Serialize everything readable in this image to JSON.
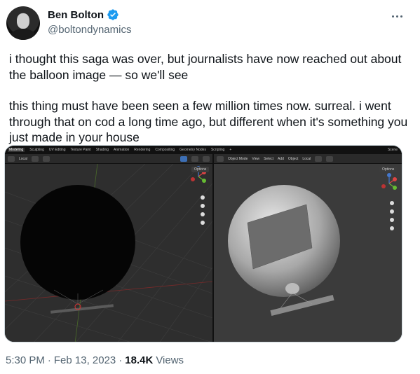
{
  "author": {
    "display_name": "Ben Bolton",
    "handle": "@boltondynamics",
    "verified_color": "#1d9bf0"
  },
  "tweet": {
    "paragraphs": [
      "i thought this saga was over, but journalists have now reached out about the balloon image — so we'll see",
      "this thing must have been seen a few million times now. surreal. i went through that on cod a long time ago, but different when it's something you just made in your house"
    ]
  },
  "media": {
    "menu_tabs": [
      "Modeling",
      "Sculpting",
      "UV Editing",
      "Texture Paint",
      "Shading",
      "Animation",
      "Rendering",
      "Compositing",
      "Geometry Nodes",
      "Scripting",
      "+"
    ],
    "scene_label": "Scene",
    "left_toolbar": {
      "transform_orientation": "Local"
    },
    "right_toolbar": {
      "mode": "Object Mode",
      "menus": [
        "View",
        "Select",
        "Add",
        "Object"
      ],
      "transform_orientation": "Local"
    },
    "options_label": "Options"
  },
  "meta": {
    "time": "5:30 PM",
    "separator": "·",
    "date": "Feb 13, 2023",
    "views_count": "18.4K",
    "views_label": "Views"
  }
}
